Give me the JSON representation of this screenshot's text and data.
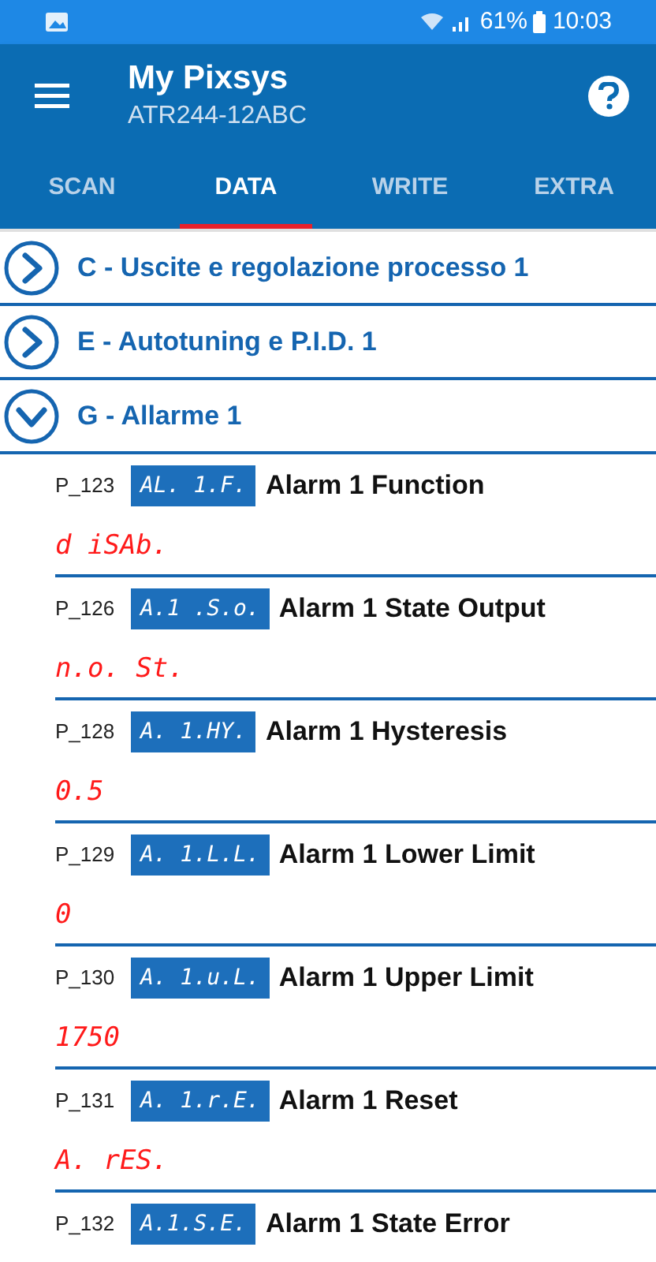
{
  "status_bar": {
    "battery": "61%",
    "time": "10:03"
  },
  "app_bar": {
    "title": "My Pixsys",
    "subtitle": "ATR244-12ABC"
  },
  "tabs": [
    {
      "label": "SCAN",
      "selected": false
    },
    {
      "label": "DATA",
      "selected": true
    },
    {
      "label": "WRITE",
      "selected": false
    },
    {
      "label": "EXTRA",
      "selected": false
    }
  ],
  "groups": [
    {
      "label": "C - Uscite e regolazione processo 1",
      "expanded": false
    },
    {
      "label": "E - Autotuning e P.I.D. 1",
      "expanded": false
    },
    {
      "label": "G - Allarme 1",
      "expanded": true,
      "params": [
        {
          "id": "P_123",
          "code": "AL. 1.F.",
          "name": "Alarm 1 Function",
          "value": "d iSAb."
        },
        {
          "id": "P_126",
          "code": "A.1 .S.o.",
          "name": "Alarm 1 State Output",
          "value": "n.o. St."
        },
        {
          "id": "P_128",
          "code": "A. 1.HY.",
          "name": "Alarm 1 Hysteresis",
          "value": "0.5"
        },
        {
          "id": "P_129",
          "code": "A. 1.L.L.",
          "name": "Alarm 1 Lower Limit",
          "value": "0"
        },
        {
          "id": "P_130",
          "code": "A. 1.u.L.",
          "name": "Alarm 1 Upper Limit",
          "value": "1750"
        },
        {
          "id": "P_131",
          "code": "A. 1.r.E.",
          "name": "Alarm 1 Reset",
          "value": "A. rES."
        },
        {
          "id": "P_132",
          "code": "A.1.S.E.",
          "name": "Alarm 1 State Error"
        }
      ]
    }
  ]
}
